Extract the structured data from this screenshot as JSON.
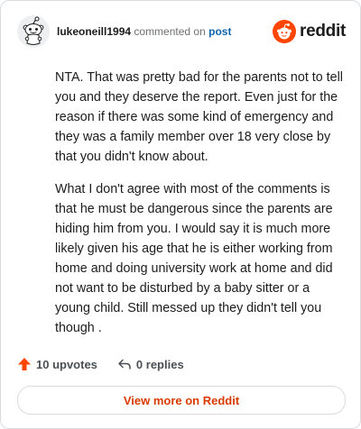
{
  "comment": {
    "username": "lukeoneill1994",
    "action_text": "commented on",
    "post_link": "post",
    "paragraphs": [
      "NTA. That was pretty bad for the parents not to tell you and they deserve the report. Even just for the reason if there was some kind of emergency and they was a family member over 18 very close by that you didn't know about.",
      "What I don't agree with most of the comments is that he must be dangerous since the parents are hiding him from you. I would say it is much more likely given his age that he is either working from home and doing university work at home and did not want to be disturbed by a baby sitter or a young child. Still messed up they didn't tell you though ."
    ]
  },
  "brand": {
    "name": "reddit",
    "color": "#ff4500"
  },
  "actions": {
    "upvotes": "10 upvotes",
    "replies": "0 replies"
  },
  "footer": {
    "view_more": "View more on Reddit"
  },
  "icons": {
    "avatar": "snoo-avatar-icon",
    "brand": "reddit-logo-icon",
    "upvote": "upvote-arrow-icon",
    "reply": "reply-arrow-icon"
  }
}
